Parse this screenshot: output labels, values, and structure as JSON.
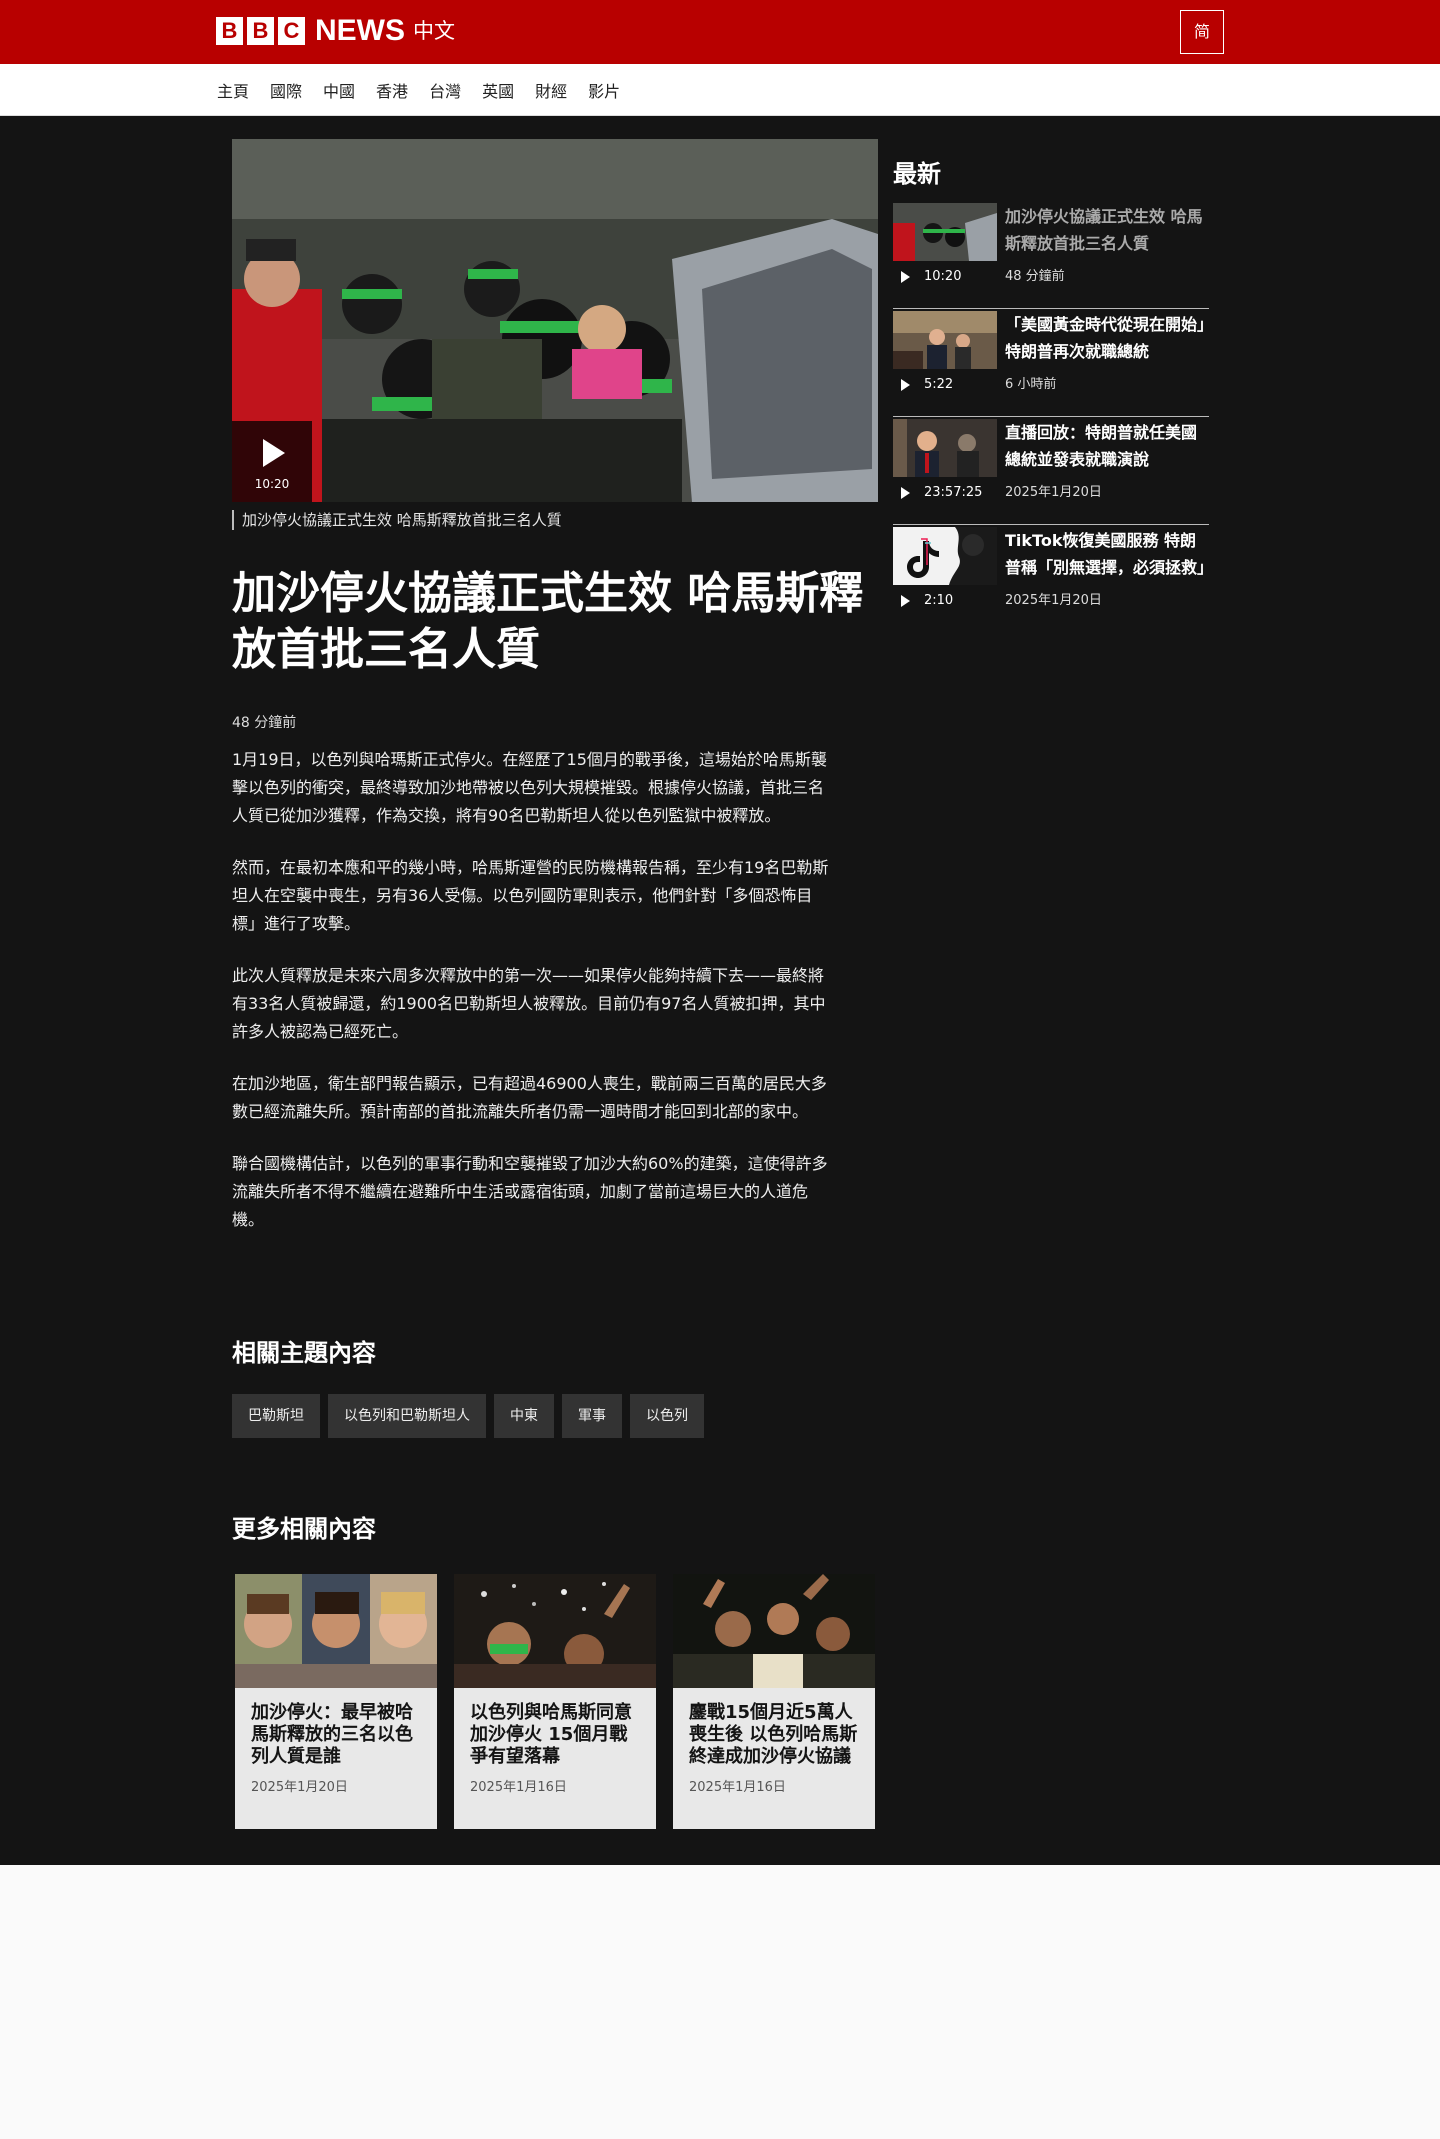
{
  "header": {
    "brand_letters": [
      "B",
      "B",
      "C"
    ],
    "brand_news": "NEWS",
    "brand_lang": "中文",
    "script_toggle": "简"
  },
  "nav": {
    "items": [
      "主頁",
      "國際",
      "中國",
      "香港",
      "台灣",
      "英國",
      "財經",
      "影片"
    ]
  },
  "article": {
    "video_duration": "10:20",
    "caption": "加沙停火協議正式生效 哈馬斯釋放首批三名人質",
    "headline": "加沙停火協議正式生效 哈馬斯釋放首批三名人質",
    "timestamp": "48 分鐘前",
    "paragraphs": [
      "1月19日，以色列與哈瑪斯正式停火。在經歷了15個月的戰爭後，這場始於哈馬斯襲擊以色列的衝突，最終導致加沙地帶被以色列大規模摧毀。根據停火協議，首批三名人質已從加沙獲釋，作為交換，將有90名巴勒斯坦人從以色列監獄中被釋放。",
      "然而，在最初本應和平的幾小時，哈馬斯運營的民防機構報告稱，至少有19名巴勒斯坦人在空襲中喪生，另有36人受傷。以色列國防軍則表示，他們針對「多個恐怖目標」進行了攻擊。",
      "此次人質釋放是未來六周多次釋放中的第一次——如果停火能夠持續下去——最終將有33名人質被歸還，約1900名巴勒斯坦人被釋放。目前仍有97名人質被扣押，其中許多人被認為已經死亡。",
      "在加沙地區，衛生部門報告顯示，已有超過46900人喪生，戰前兩三百萬的居民大多數已經流離失所。預計南部的首批流離失所者仍需一週時間才能回到北部的家中。",
      "聯合國機構估計，以色列的軍事行動和空襲摧毀了加沙大約60%的建築，這使得許多流離失所者不得不繼續在避難所中生活或露宿街頭，加劇了當前這場巨大的人道危機。"
    ]
  },
  "related": {
    "title": "相關主題內容",
    "tags": [
      "巴勒斯坦",
      "以色列和巴勒斯坦人",
      "中東",
      "軍事",
      "以色列"
    ]
  },
  "more": {
    "title": "更多相關內容",
    "cards": [
      {
        "title": "加沙停火：最早被哈馬斯釋放的三名以色列人質是誰",
        "date": "2025年1月20日"
      },
      {
        "title": "以色列與哈馬斯同意加沙停火 15個月戰爭有望落幕",
        "date": "2025年1月16日"
      },
      {
        "title": "鏖戰15個月近5萬人喪生後 以色列哈馬斯終達成加沙停火協議",
        "date": "2025年1月16日"
      }
    ]
  },
  "sidebar": {
    "title": "最新",
    "items": [
      {
        "headline": "加沙停火協議正式生效 哈馬斯釋放首批三名人質",
        "duration": "10:20",
        "time": "48 分鐘前"
      },
      {
        "headline": "「美國黃金時代從現在開始」特朗普再次就職總統",
        "duration": "5:22",
        "time": "6 小時前"
      },
      {
        "headline": "直播回放：特朗普就任美國總統並發表就職演說",
        "duration": "23:57:25",
        "time": "2025年1月20日"
      },
      {
        "headline": "TikTok恢復美國服務 特朗普稱「別無選擇，必須拯救」",
        "duration": "2:10",
        "time": "2025年1月20日"
      }
    ]
  },
  "colors": {
    "brand_red": "#b80000",
    "page_dark": "#141414",
    "card_bg": "#e8e8e8",
    "tag_bg": "#333333",
    "hamas_band_green": "#2fb54a"
  }
}
